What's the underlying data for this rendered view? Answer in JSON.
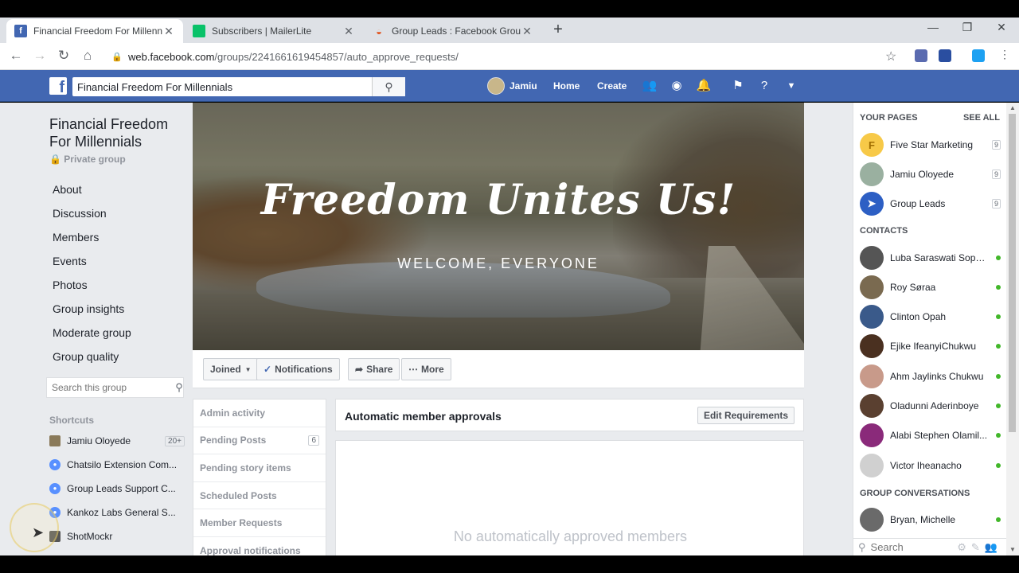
{
  "browser": {
    "tabs": [
      {
        "title": "Financial Freedom For Millennials",
        "favicon": "facebook-icon",
        "color": "#4267b2",
        "active": true
      },
      {
        "title": "Subscribers | MailerLite",
        "favicon": "mailerlite-icon",
        "color": "#09c269",
        "active": false
      },
      {
        "title": "Group Leads : Facebook Group Le",
        "favicon": "group-leads-icon",
        "color": "#e0531e",
        "active": false
      }
    ],
    "url_host": "web.facebook.com",
    "url_path": "/groups/2241661619454857/auto_approve_requests/"
  },
  "fb": {
    "search_value": "Financial Freedom For Millennials",
    "user_name": "Jamiu",
    "home_label": "Home",
    "create_label": "Create",
    "brand_color": "#4267b2"
  },
  "group": {
    "title": "Financial Freedom For Millennials",
    "privacy": "Private group",
    "nav": [
      "About",
      "Discussion",
      "Members",
      "Events",
      "Photos",
      "Group insights",
      "Moderate group",
      "Group quality"
    ],
    "search_placeholder": "Search this group",
    "cover_title": "Freedom Unites Us!",
    "cover_subtitle": "WELCOME, EVERYONE",
    "actions": {
      "joined": "Joined",
      "notifications": "Notifications",
      "share": "Share",
      "more": "More"
    }
  },
  "shortcuts": {
    "heading": "Shortcuts",
    "items": [
      {
        "label": "Jamiu Oloyede",
        "badge": "20+"
      },
      {
        "label": "Chatsilo Extension Com...",
        "badge": ""
      },
      {
        "label": "Group Leads Support C...",
        "badge": ""
      },
      {
        "label": "Kankoz Labs General S...",
        "badge": ""
      },
      {
        "label": "ShotMockr",
        "badge": ""
      }
    ]
  },
  "admin_menu": [
    {
      "label": "Admin activity",
      "count": ""
    },
    {
      "label": "Pending Posts",
      "count": "6"
    },
    {
      "label": "Pending story items",
      "count": ""
    },
    {
      "label": "Scheduled Posts",
      "count": ""
    },
    {
      "label": "Member Requests",
      "count": ""
    },
    {
      "label": "Approval notifications",
      "count": ""
    }
  ],
  "panel": {
    "title": "Automatic member approvals",
    "edit_label": "Edit Requirements",
    "empty_text": "No automatically approved members"
  },
  "sidebar_right": {
    "pages_heading": "YOUR PAGES",
    "see_all": "SEE ALL",
    "pages": [
      {
        "name": "Five Star Marketing",
        "badge": "9",
        "initial": "F",
        "color": "#f7c948"
      },
      {
        "name": "Jamiu Oloyede",
        "badge": "9",
        "initial": "",
        "color": "#9ab0a0"
      },
      {
        "name": "Group Leads",
        "badge": "9",
        "initial": "",
        "color": "#2d5fc4"
      }
    ],
    "contacts_heading": "CONTACTS",
    "contacts": [
      {
        "name": "Luba Saraswati Sophi...",
        "color": "#555"
      },
      {
        "name": "Roy Søraa",
        "color": "#7a6a50"
      },
      {
        "name": "Clinton Opah",
        "color": "#3a5a8a"
      },
      {
        "name": "Ejike IfeanyiChukwu",
        "color": "#4a3020"
      },
      {
        "name": "Ahm Jaylinks Chukwu",
        "color": "#c89a8a"
      },
      {
        "name": "Oladunni Aderinboye",
        "color": "#5a4030"
      },
      {
        "name": "Alabi Stephen Olamil...",
        "color": "#8a2a7a"
      },
      {
        "name": "Victor Iheanacho",
        "color": "#d0d0d0"
      }
    ],
    "group_conv_heading": "GROUP CONVERSATIONS",
    "group_convs": [
      {
        "name": "Bryan, Michelle",
        "color": "#6a6a6a"
      }
    ],
    "search_placeholder": "Search"
  }
}
